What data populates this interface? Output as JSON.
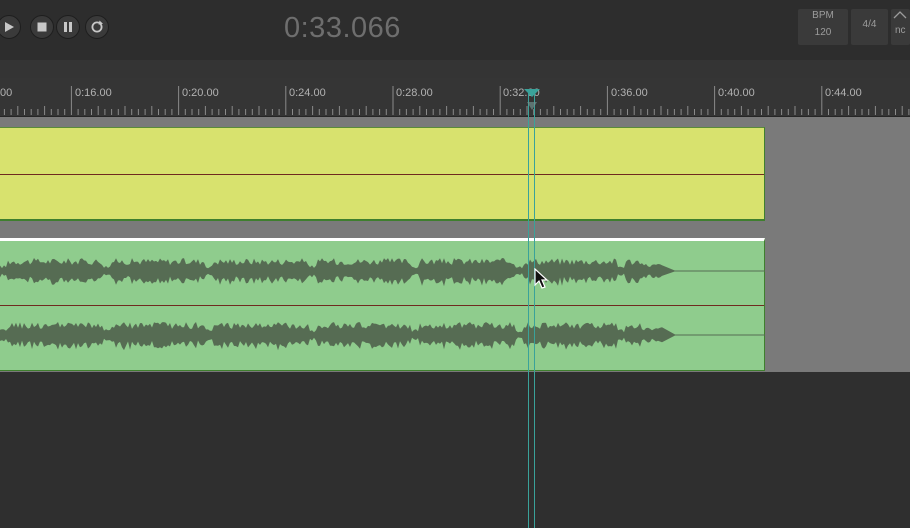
{
  "transport": {
    "buttons": [
      {
        "name": "play-button",
        "icon": "play-icon"
      },
      {
        "name": "stop-button",
        "icon": "stop-icon"
      },
      {
        "name": "pause-button",
        "icon": "pause-icon"
      },
      {
        "name": "loop-button",
        "icon": "loop-icon"
      }
    ]
  },
  "time_display": "0:33.066",
  "tempo": {
    "label": "BPM",
    "value": "120"
  },
  "time_signature": "4/4",
  "snap": {
    "value": "nc"
  },
  "ruler": {
    "labels": [
      "00",
      "0:16.00",
      "0:20.00",
      "0:24.00",
      "0:28.00",
      "0:32.00",
      "0:36.00",
      "0:40.00",
      "0:44.00"
    ]
  },
  "tracks": [
    {
      "name": "yellow-track",
      "color": "#d8e26e"
    },
    {
      "name": "audio-track",
      "color": "#8fcc8d",
      "waveform_color": "#566c53"
    }
  ],
  "colors": {
    "background": "#2f2f2f",
    "playhead": "#3aa29a",
    "center_line": "#6f2a1f"
  }
}
